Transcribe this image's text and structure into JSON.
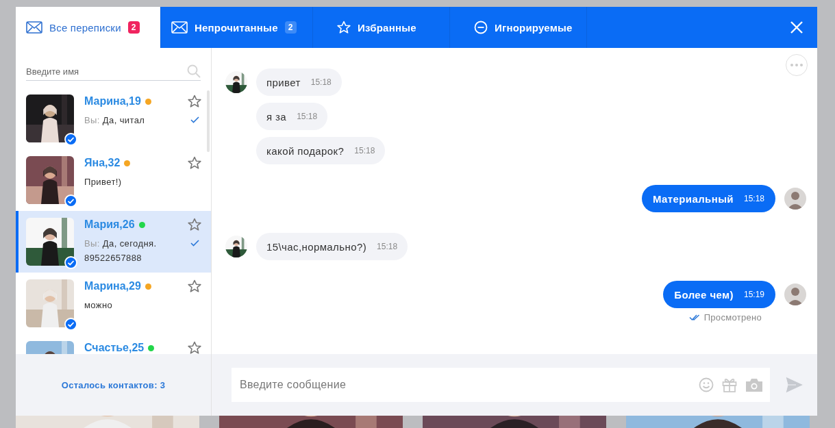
{
  "tabs": [
    {
      "label": "Все переписки",
      "badge": "2",
      "kind": "envelope",
      "selected": true
    },
    {
      "label": "Непрочитанные",
      "badge": "2",
      "kind": "envelope",
      "selected": false
    },
    {
      "label": "Избранные",
      "kind": "star",
      "selected": false
    },
    {
      "label": "Игнорируемые",
      "kind": "minus",
      "selected": false
    }
  ],
  "search": {
    "placeholder": "Введите имя"
  },
  "contacts": [
    {
      "name": "Марина,19",
      "color": "#f5a623",
      "prefix": "Вы:",
      "preview": "Да, читал",
      "read": true,
      "verified": true,
      "favorite": false,
      "selected": false
    },
    {
      "name": "Яна,32",
      "color": "#f5a623",
      "preview": "Привет!)",
      "read": false,
      "verified": true,
      "favorite": false,
      "selected": false
    },
    {
      "name": "Мария,26",
      "color": "#22d64a",
      "prefix": "Вы:",
      "preview": "Да, сегодня. 89522657888",
      "read": true,
      "verified": true,
      "favorite": false,
      "selected": true
    },
    {
      "name": "Марина,29",
      "color": "#f5a623",
      "preview": "можно",
      "read": false,
      "verified": true,
      "favorite": false,
      "selected": false
    },
    {
      "name": "Счастье,25",
      "color": "#22d64a",
      "favorite": false,
      "selected": false
    }
  ],
  "contacts_left": "Осталось контактов: 3",
  "messages": [
    {
      "kind": "incoming",
      "text": "привет",
      "time": "15:18",
      "avatar": true,
      "group_start": true
    },
    {
      "kind": "incoming",
      "text": "я за",
      "time": "15:18",
      "avatar": false,
      "group_start": false
    },
    {
      "kind": "incoming",
      "text": "какой подарок?",
      "time": "15:18",
      "avatar": false,
      "group_start": false
    },
    {
      "kind": "outgoing",
      "text": "Материальный",
      "time": "15:18",
      "avatar": true,
      "group_start": true
    },
    {
      "kind": "incoming",
      "text": "15\\час,нормально?)",
      "time": "15:18",
      "avatar": true,
      "group_start": true
    },
    {
      "kind": "outgoing",
      "text": "Более чем)",
      "time": "15:19",
      "avatar": true,
      "group_start": true,
      "status": "Просмотрено"
    }
  ],
  "composer": {
    "placeholder": "Введите сообщение"
  }
}
